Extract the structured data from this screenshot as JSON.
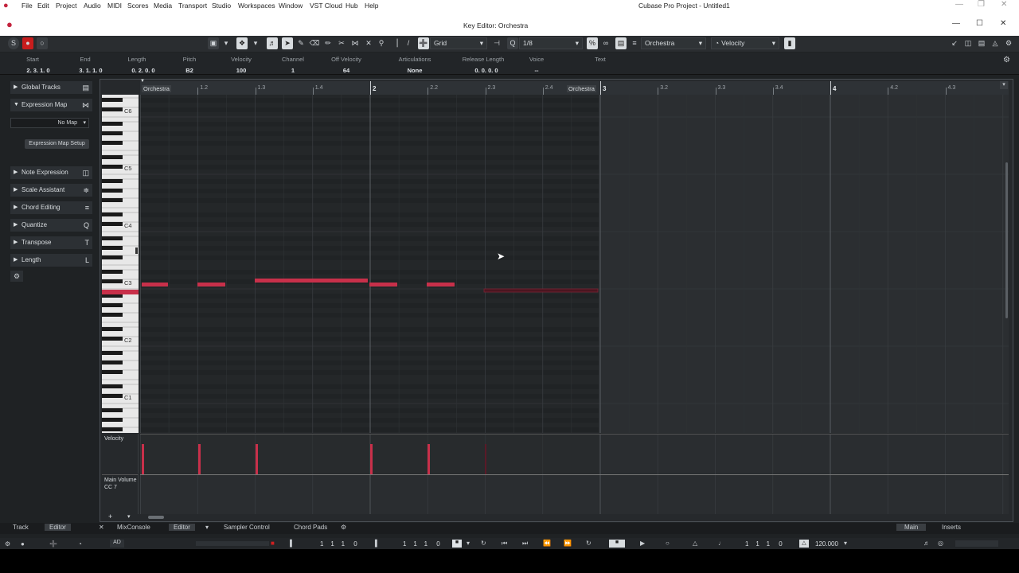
{
  "menu": [
    "File",
    "Edit",
    "Project",
    "Audio",
    "MIDI",
    "Scores",
    "Media",
    "Transport",
    "Studio",
    "Workspaces",
    "Window",
    "VST Cloud",
    "Hub",
    "Help"
  ],
  "app_title": "Cubase Pro Project - Untitled1",
  "window_title": "Key Editor: Orchestra",
  "toolbar": {
    "grid_type": "Grid",
    "quantize": "1/8",
    "track_select": "Orchestra",
    "controller_select": "Velocity"
  },
  "info_line": {
    "headers": [
      "Start",
      "End",
      "Length",
      "Pitch",
      "Velocity",
      "Channel",
      "Off Velocity",
      "Articulations",
      "Release Length",
      "Voice",
      "Text"
    ],
    "values": [
      "2. 3. 1.   0",
      "3. 1. 1.   0",
      "0. 2. 0.   0",
      "B2",
      "100",
      "1",
      "64",
      "None",
      "0. 0. 0.   0",
      "--",
      ""
    ]
  },
  "inspector": {
    "global_tracks": "Global Tracks",
    "expression_map": "Expression Map",
    "no_map": "No Map",
    "map_setup": "Expression Map Setup",
    "note_expression": "Note Expression",
    "scale_assistant": "Scale Assistant",
    "chord_editing": "Chord Editing",
    "quantize": "Quantize",
    "transpose": "Transpose",
    "length": "Length"
  },
  "ruler": {
    "part_label_1": "Orchestra",
    "part_label_2": "Orchestra",
    "ticks": [
      "1.2",
      "1.3",
      "1.4",
      "2",
      "2.2",
      "2.3",
      "2.4",
      "3",
      "3.2",
      "3.3",
      "3.4",
      "4",
      "4.2",
      "4.3"
    ]
  },
  "piano_labels": [
    "C6",
    "C5",
    "C4",
    "C3",
    "C2",
    "C1"
  ],
  "lanes": {
    "velocity": "Velocity",
    "main_volume": "Main Volume",
    "cc": "CC 7"
  },
  "bottom_tabs": {
    "track": "Track",
    "editor": "Editor",
    "mixconsole": "MixConsole",
    "editor2": "Editor",
    "sampler": "Sampler Control",
    "chord_pads": "Chord Pads",
    "main": "Main",
    "inserts": "Inserts"
  },
  "transport": {
    "pos1": "1    1    1     0",
    "pos2": "1    1    1     0",
    "pos3": "1    1    1     0",
    "tempo": "120.000"
  },
  "colors": {
    "note": "#c8304a",
    "accent": "#d02020"
  }
}
